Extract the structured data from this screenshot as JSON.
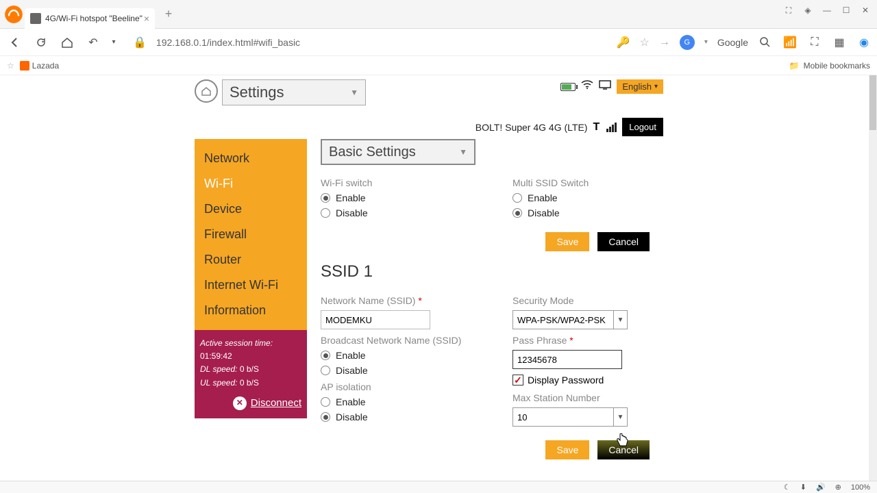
{
  "browser": {
    "tab_title": "4G/Wi-Fi hotspot \"Beeline\"",
    "url": "192.168.0.1/index.html#wifi_basic",
    "search_engine": "Google",
    "bookmark1": "Lazada",
    "mobile_bookmarks": "Mobile bookmarks"
  },
  "header": {
    "settings_label": "Settings",
    "language": "English",
    "carrier": "BOLT! Super 4G 4G (LTE)",
    "logout": "Logout"
  },
  "sidebar": {
    "items": [
      "Network",
      "Wi-Fi",
      "Device",
      "Firewall",
      "Router",
      "Internet Wi-Fi",
      "Information"
    ],
    "active_index": 1
  },
  "session": {
    "title": "Active session time:",
    "time": "01:59:42",
    "dl_label": "DL speed:",
    "dl_value": "0 b/S",
    "ul_label": "UL speed:",
    "ul_value": "0 b/S",
    "disconnect": "Disconnect"
  },
  "content": {
    "subsection": "Basic Settings",
    "wifi_switch_label": "Wi-Fi switch",
    "multi_ssid_label": "Multi SSID Switch",
    "enable": "Enable",
    "disable": "Disable",
    "save": "Save",
    "cancel": "Cancel",
    "ssid1_head": "SSID 1",
    "network_name_label": "Network Name (SSID)",
    "network_name_value": "MODEMKU",
    "broadcast_label": "Broadcast Network Name (SSID)",
    "ap_isolation_label": "AP isolation",
    "security_mode_label": "Security Mode",
    "security_mode_value": "WPA-PSK/WPA2-PSK",
    "passphrase_label": "Pass Phrase",
    "passphrase_value": "12345678",
    "display_password": "Display Password",
    "max_station_label": "Max Station Number",
    "max_station_value": "10"
  },
  "statusbar": {
    "zoom": "100%"
  }
}
